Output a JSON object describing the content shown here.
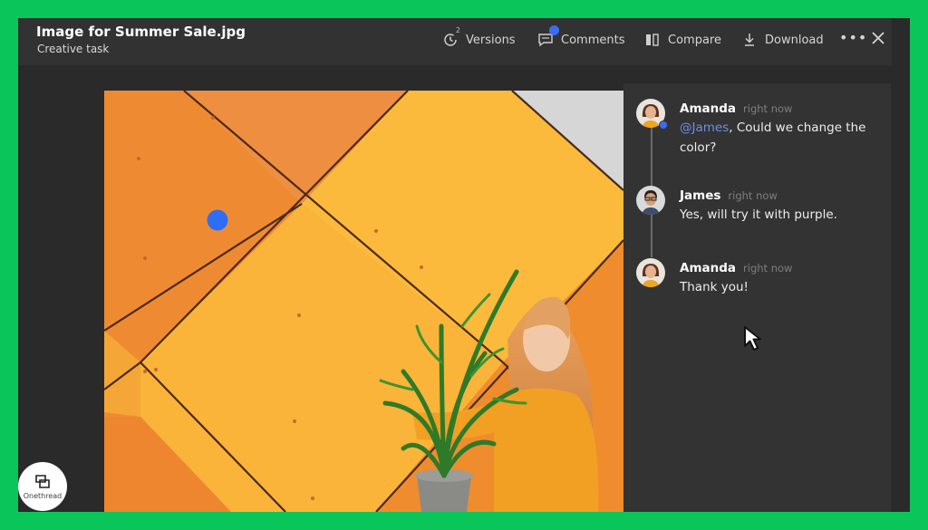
{
  "file": {
    "title": "Image for Summer Sale.jpg",
    "subtitle": "Creative task"
  },
  "toolbar": {
    "versions_label": "Versions",
    "versions_count": "2",
    "comments_label": "Comments",
    "compare_label": "Compare",
    "download_label": "Download",
    "more_label": "•••"
  },
  "comments": [
    {
      "author": "Amanda",
      "time": "right now",
      "mention": "@James",
      "text": ", Could we change the color?"
    },
    {
      "author": "James",
      "time": "right now",
      "text": "Yes, will try it with purple."
    },
    {
      "author": "Amanda",
      "time": "right now",
      "text": "Thank you!"
    }
  ],
  "brand": {
    "name": "Onethread"
  },
  "colors": {
    "accent": "#3b6cf6",
    "frame": "#0ac65a",
    "panel": "#333333",
    "background": "#2a2a2a"
  },
  "icons": [
    "versions-clock-icon",
    "comments-icon",
    "compare-icon",
    "download-icon",
    "more-icon",
    "close-icon",
    "cursor-arrow-icon",
    "onethread-logo-icon"
  ]
}
